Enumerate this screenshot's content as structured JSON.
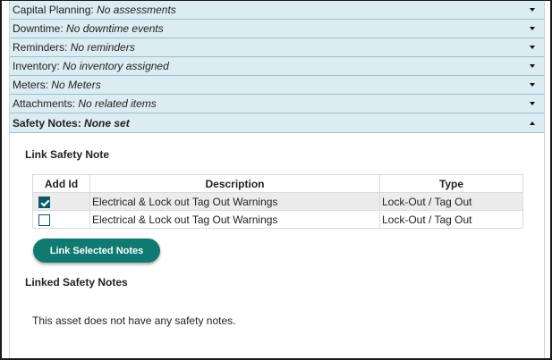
{
  "accordion": [
    {
      "label": "Capital Planning:",
      "value": "No assessments"
    },
    {
      "label": "Downtime:",
      "value": "No downtime events"
    },
    {
      "label": "Reminders:",
      "value": "No reminders"
    },
    {
      "label": "Inventory:",
      "value": "No inventory assigned"
    },
    {
      "label": "Meters:",
      "value": "No Meters"
    },
    {
      "label": "Attachments:",
      "value": "No related items"
    }
  ],
  "safety": {
    "header_label": "Safety Notes:",
    "header_value": "None set",
    "link_title": "Link Safety Note",
    "columns": [
      "Add Id",
      "Description",
      "Type"
    ],
    "rows": [
      {
        "checked": true,
        "description": "Electrical & Lock out Tag Out Warnings",
        "type": "Lock-Out / Tag Out"
      },
      {
        "checked": false,
        "description": "Electrical & Lock out Tag Out Warnings",
        "type": "Lock-Out / Tag Out"
      }
    ],
    "link_button": "Link Selected Notes",
    "linked_title": "Linked Safety Notes",
    "empty_message": "This asset does not have any safety notes."
  },
  "colors": {
    "header_bg": "#dbecf2",
    "accent": "#0f7a72",
    "checkbox": "#0b5a63"
  }
}
